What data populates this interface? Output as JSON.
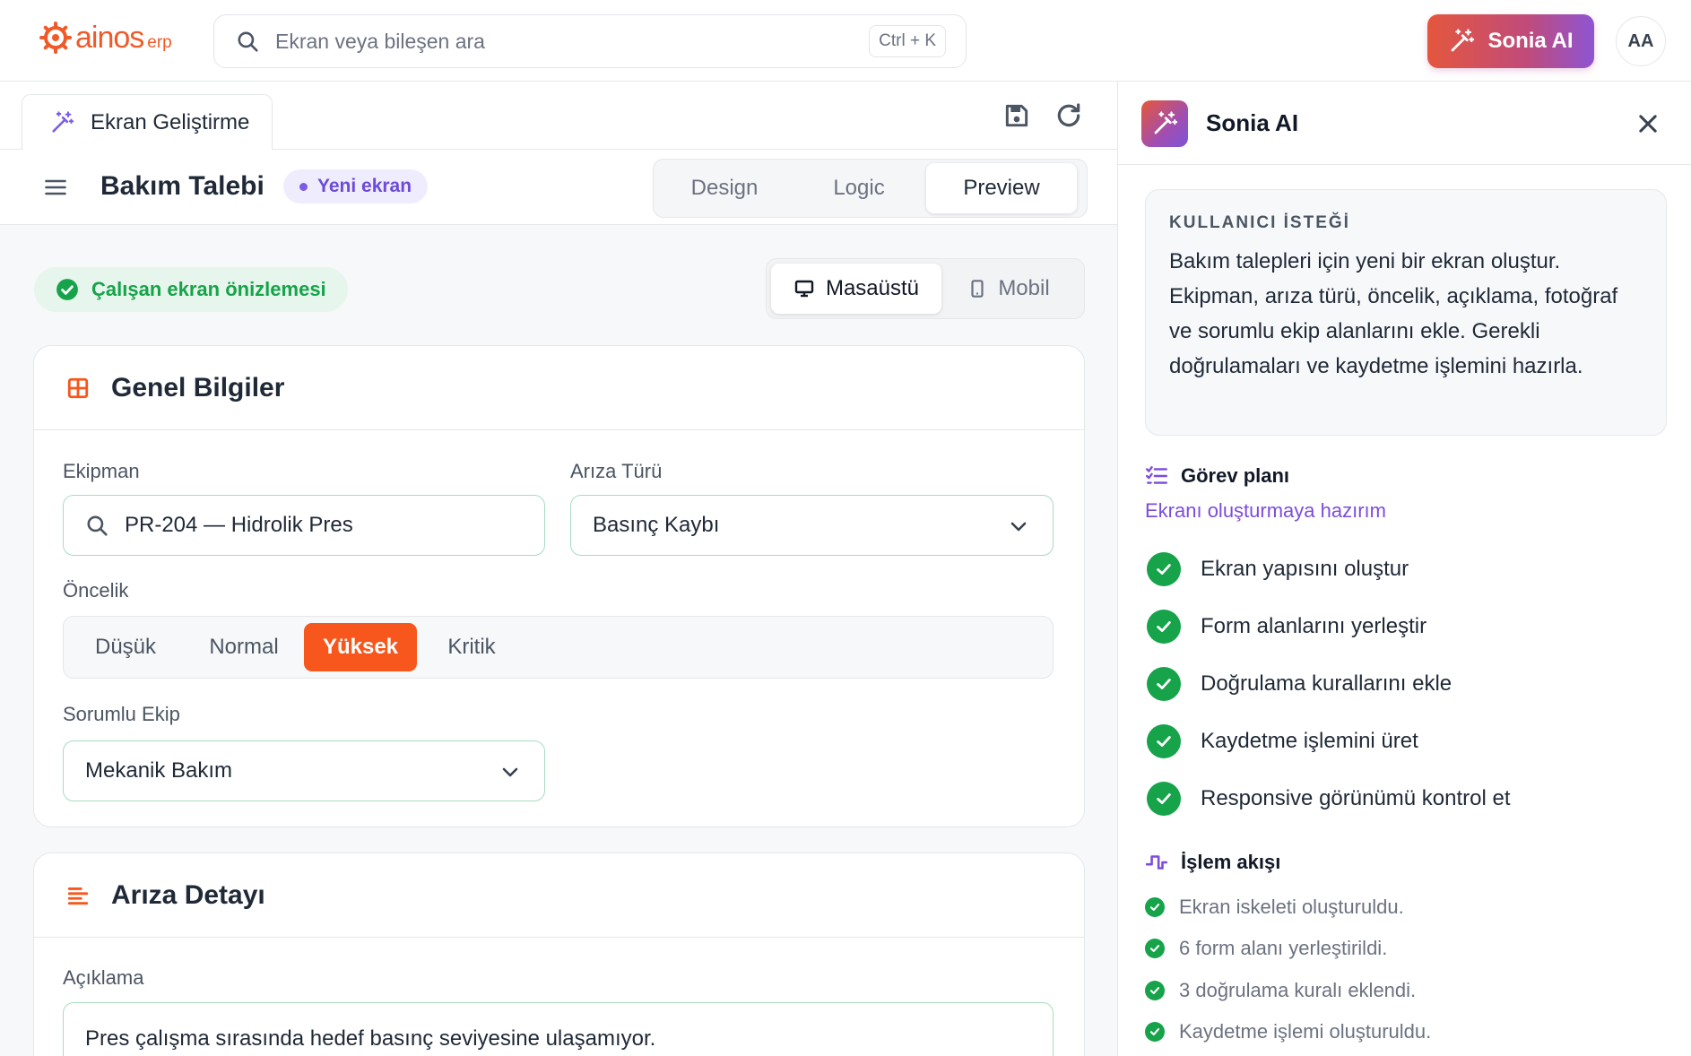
{
  "brand": {
    "logo_text": "ainos",
    "logo_sub": "erp",
    "color": "#f05a28"
  },
  "search": {
    "placeholder": "Ekran veya bileşen ara",
    "shortcut": "Ctrl + K"
  },
  "header": {
    "ai_button_label": "Sonia AI",
    "avatar_initials": "AA"
  },
  "workspace": {
    "tab_label": "Ekran Geliştirme",
    "screen_title": "Bakım Talebi",
    "status_badge": "Yeni ekran",
    "modes": [
      "Design",
      "Logic",
      "Preview"
    ],
    "active_mode": "Preview"
  },
  "preview": {
    "status": "Çalışan ekran önizlemesi",
    "devices": [
      "Masaüstü",
      "Mobil"
    ],
    "active_device": "Masaüstü"
  },
  "form": {
    "general": {
      "title": "Genel Bilgiler",
      "equipment_label": "Ekipman",
      "equipment_value": "PR-204 — Hidrolik Pres",
      "fault_label": "Arıza Türü",
      "fault_value": "Basınç Kaybı",
      "priority_label": "Öncelik",
      "priority_options": [
        "Düşük",
        "Normal",
        "Yüksek",
        "Kritik"
      ],
      "priority_selected": "Yüksek",
      "team_label": "Sorumlu Ekip",
      "team_value": "Mekanik Bakım"
    },
    "detail": {
      "title": "Arıza Detayı",
      "description_label": "Açıklama",
      "description_value": "Pres çalışma sırasında hedef basınç seviyesine ulaşamıyor."
    }
  },
  "panel": {
    "title": "Sonia AI",
    "request_label": "KULLANICI İSTEĞİ",
    "request_text": "Bakım talepleri için yeni bir ekran oluştur. Ekipman, arıza türü, öncelik, açıklama, fotoğraf ve sorumlu ekip alanlarını ekle. Gerekli doğrulamaları ve kaydetme işlemini hazırla.",
    "plan_title": "Görev planı",
    "plan_status": "Ekranı oluşturmaya hazırım",
    "tasks": [
      "Ekran yapısını oluştur",
      "Form alanlarını yerleştir",
      "Doğrulama kurallarını ekle",
      "Kaydetme işlemini üret",
      "Responsive görünümü kontrol et"
    ],
    "flow_title": "İşlem akışı",
    "flow_items": [
      "Ekran iskeleti oluşturuldu.",
      "6 form alanı yerleştirildi.",
      "3 doğrulama kuralı eklendi.",
      "Kaydetme işlemi oluşturuldu."
    ]
  },
  "colors": {
    "accent_orange": "#f7561c",
    "success_green": "#16a34a",
    "ai_purple": "#7c4ddb",
    "input_border": "#a7dcc0"
  }
}
